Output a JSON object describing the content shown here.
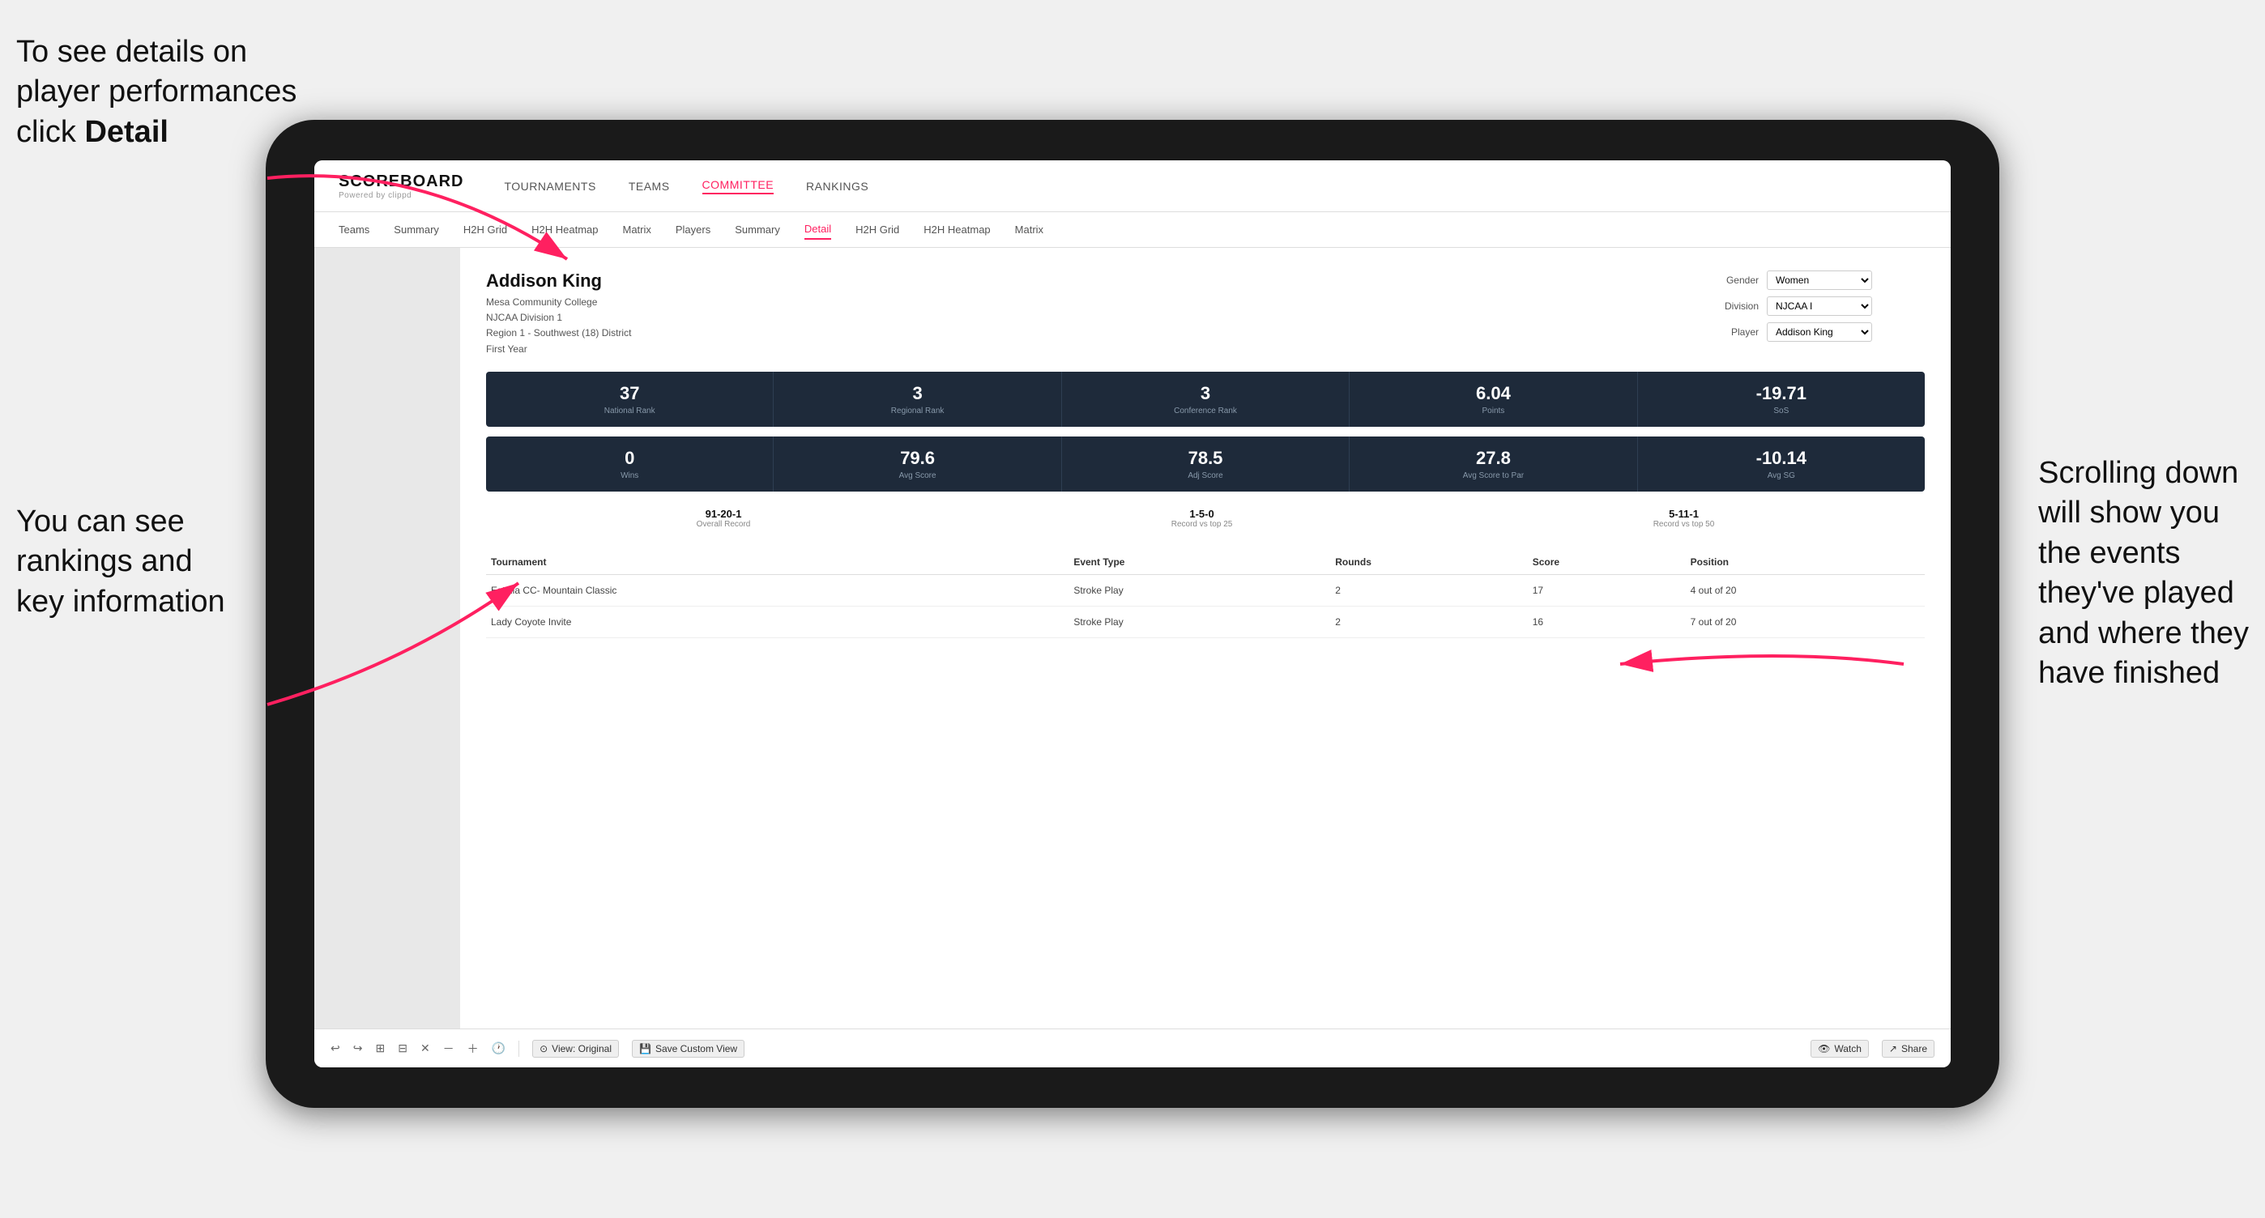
{
  "annotations": {
    "topleft": {
      "line1": "To see details on",
      "line2": "player performances",
      "line3prefix": "click ",
      "line3bold": "Detail"
    },
    "bottomleft": {
      "line1": "You can see",
      "line2": "rankings and",
      "line3": "key information"
    },
    "right": {
      "line1": "Scrolling down",
      "line2": "will show you",
      "line3": "the events",
      "line4": "they've played",
      "line5": "and where they",
      "line6": "have finished"
    }
  },
  "logo": {
    "text": "SCOREBOARD",
    "sub": "Powered by clippd"
  },
  "top_nav": {
    "items": [
      {
        "label": "TOURNAMENTS",
        "active": false
      },
      {
        "label": "TEAMS",
        "active": false
      },
      {
        "label": "COMMITTEE",
        "active": true
      },
      {
        "label": "RANKINGS",
        "active": false
      }
    ]
  },
  "sub_nav": {
    "items": [
      {
        "label": "Teams",
        "active": false
      },
      {
        "label": "Summary",
        "active": false
      },
      {
        "label": "H2H Grid",
        "active": false
      },
      {
        "label": "H2H Heatmap",
        "active": false
      },
      {
        "label": "Matrix",
        "active": false
      },
      {
        "label": "Players",
        "active": false
      },
      {
        "label": "Summary",
        "active": false
      },
      {
        "label": "Detail",
        "active": true
      },
      {
        "label": "H2H Grid",
        "active": false
      },
      {
        "label": "H2H Heatmap",
        "active": false
      },
      {
        "label": "Matrix",
        "active": false
      }
    ]
  },
  "player": {
    "name": "Addison King",
    "college": "Mesa Community College",
    "division": "NJCAA Division 1",
    "region": "Region 1 - Southwest (18) District",
    "year": "First Year"
  },
  "controls": {
    "gender_label": "Gender",
    "gender_value": "Women",
    "division_label": "Division",
    "division_value": "NJCAA I",
    "player_label": "Player",
    "player_value": "Addison King"
  },
  "stats_row1": [
    {
      "value": "37",
      "label": "National Rank"
    },
    {
      "value": "3",
      "label": "Regional Rank"
    },
    {
      "value": "3",
      "label": "Conference Rank"
    },
    {
      "value": "6.04",
      "label": "Points"
    },
    {
      "value": "-19.71",
      "label": "SoS"
    }
  ],
  "stats_row2": [
    {
      "value": "0",
      "label": "Wins"
    },
    {
      "value": "79.6",
      "label": "Avg Score"
    },
    {
      "value": "78.5",
      "label": "Adj Score"
    },
    {
      "value": "27.8",
      "label": "Avg Score to Par"
    },
    {
      "value": "-10.14",
      "label": "Avg SG"
    }
  ],
  "records": [
    {
      "value": "91-20-1",
      "label": "Overall Record"
    },
    {
      "value": "1-5-0",
      "label": "Record vs top 25"
    },
    {
      "value": "5-11-1",
      "label": "Record vs top 50"
    }
  ],
  "table": {
    "headers": [
      "Tournament",
      "Event Type",
      "Rounds",
      "Score",
      "Position"
    ],
    "rows": [
      {
        "tournament": "Estella CC- Mountain Classic",
        "event_type": "Stroke Play",
        "rounds": "2",
        "score": "17",
        "position": "4 out of 20"
      },
      {
        "tournament": "Lady Coyote Invite",
        "event_type": "Stroke Play",
        "rounds": "2",
        "score": "16",
        "position": "7 out of 20"
      }
    ]
  },
  "toolbar": {
    "buttons": [
      {
        "label": "⟲"
      },
      {
        "label": "⟳"
      },
      {
        "label": "⊞"
      },
      {
        "label": "⊟"
      },
      {
        "label": "⊠"
      },
      {
        "label": "–"
      },
      {
        "label": "+"
      },
      {
        "label": "🕐"
      }
    ],
    "view_btn": "View: Original",
    "save_btn": "Save Custom View",
    "watch_btn": "Watch",
    "share_btn": "Share"
  }
}
